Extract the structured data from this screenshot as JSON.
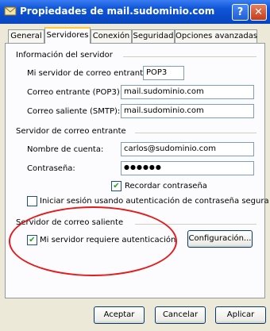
{
  "window": {
    "title": "Propiedades de mail.sudominio.com",
    "help": "?",
    "close": "✕"
  },
  "tabs": [
    {
      "label": "General"
    },
    {
      "label": "Servidores"
    },
    {
      "label": "Conexión"
    },
    {
      "label": "Seguridad"
    },
    {
      "label": "Opciones avanzadas"
    }
  ],
  "server_info": {
    "group": "Información del servidor",
    "incoming_type_label": "Mi servidor de correo entrante es",
    "incoming_type_value": "POP3",
    "incoming_label": "Correo entrante (POP3):",
    "incoming_value": "mail.sudominio.com",
    "outgoing_label": "Correo saliente (SMTP):",
    "outgoing_value": "mail.sudominio.com"
  },
  "incoming_server": {
    "group": "Servidor de correo entrante",
    "account_label": "Nombre de cuenta:",
    "account_value": "carlos@sudominio.com",
    "password_label": "Contraseña:",
    "password_value": "●●●●●●",
    "remember_label": "Recordar contraseña",
    "remember_checked": true,
    "spa_label": "Iniciar sesión usando autenticación de contraseña segura",
    "spa_checked": false
  },
  "outgoing_server": {
    "group": "Servidor de correo saliente",
    "auth_label": "Mi servidor requiere autenticación",
    "auth_checked": true,
    "settings_button": "Configuración..."
  },
  "footer": {
    "ok": "Aceptar",
    "cancel": "Cancelar",
    "apply": "Aplicar"
  },
  "colors": {
    "title_bar": "#0A4BC9",
    "highlight_ellipse": "#E41B1B",
    "dialog_bg": "#ECE9D8"
  }
}
